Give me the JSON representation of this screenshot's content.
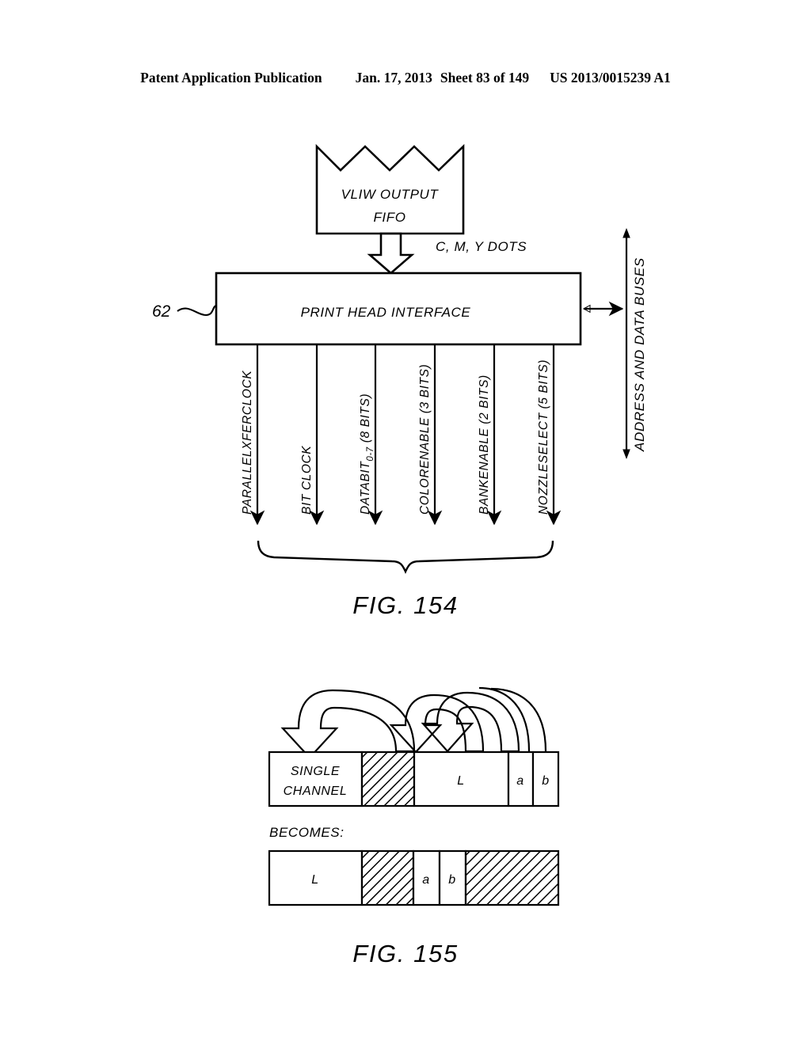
{
  "header": {
    "publication": "Patent Application Publication",
    "date": "Jan. 17, 2013",
    "sheet": "Sheet 83 of 149",
    "patent_number": "US 2013/0015239 A1"
  },
  "fig154": {
    "caption": "FIG. 154",
    "reference_numeral": "62",
    "fifo_block": {
      "line1": "VLIW OUTPUT",
      "line2": "FIFO"
    },
    "interface_block": {
      "label": "PRINT HEAD INTERFACE"
    },
    "dots_label": "C, M, Y DOTS",
    "bus_label": "ADDRESS AND DATA BUSES",
    "signals": [
      {
        "name": "PARALLELXFERCLOCK",
        "sub": "",
        "tail": ""
      },
      {
        "name": "BIT CLOCK",
        "sub": "",
        "tail": ""
      },
      {
        "name": "DATABIT",
        "sub": "0-7",
        "tail": " (8 BITS)"
      },
      {
        "name": "COLORENABLE (3 BITS)",
        "sub": "",
        "tail": ""
      },
      {
        "name": "BANKENABLE (2 BITS)",
        "sub": "",
        "tail": ""
      },
      {
        "name": "NOZZLESELECT (5 BITS)",
        "sub": "",
        "tail": ""
      }
    ]
  },
  "fig155": {
    "caption": "FIG. 155",
    "becomes_label": "BECOMES:",
    "before_bar": {
      "cells": [
        {
          "label_line1": "SINGLE",
          "label_line2": "CHANNEL",
          "hatched": false
        },
        {
          "label_line1": "",
          "label_line2": "",
          "hatched": true
        },
        {
          "label_line1": "L",
          "label_line2": "",
          "hatched": false
        },
        {
          "label_line1": "a",
          "label_line2": "",
          "hatched": false
        },
        {
          "label_line1": "b",
          "label_line2": "",
          "hatched": false
        }
      ]
    },
    "after_bar": {
      "cells": [
        {
          "label_line1": "L",
          "hatched": false
        },
        {
          "label_line1": "",
          "hatched": true
        },
        {
          "label_line1": "a",
          "hatched": false
        },
        {
          "label_line1": "b",
          "hatched": false
        },
        {
          "label_line1": "",
          "hatched": true
        }
      ]
    }
  },
  "colors": {
    "ink": "#000000",
    "paper": "#ffffff"
  }
}
